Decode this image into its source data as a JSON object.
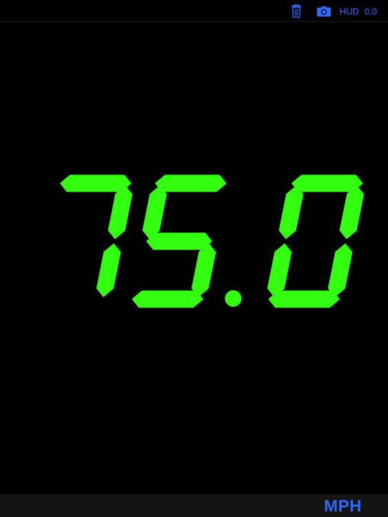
{
  "toolbar": {
    "hud_label": "HUD",
    "hud_value": "0.0"
  },
  "display": {
    "speed": "75.0",
    "digit_color": "#33ff11"
  },
  "footer": {
    "unit": "MPH"
  },
  "colors": {
    "accent": "#2f6bff",
    "background": "#000000",
    "bottom_bar": "#141414"
  },
  "icons": {
    "trash": "trash-icon",
    "camera": "camera-icon"
  }
}
